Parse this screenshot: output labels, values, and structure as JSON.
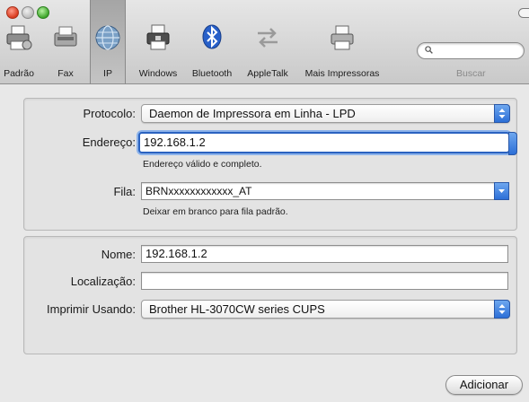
{
  "toolbar": {
    "items": [
      {
        "label": "Padrão",
        "icon": "printer-default-icon"
      },
      {
        "label": "Fax",
        "icon": "fax-icon"
      },
      {
        "label": "IP",
        "icon": "globe-icon"
      },
      {
        "label": "Windows",
        "icon": "windows-printer-icon"
      },
      {
        "label": "Bluetooth",
        "icon": "bluetooth-icon"
      },
      {
        "label": "AppleTalk",
        "icon": "appletalk-icon"
      },
      {
        "label": "Mais Impressoras",
        "icon": "more-printers-icon"
      }
    ],
    "selected": "IP",
    "search": {
      "label": "Buscar",
      "value": ""
    }
  },
  "connection": {
    "protocol_label": "Protocolo:",
    "protocol_value": "Daemon de Impressora em Linha - LPD",
    "address_label": "Endereço:",
    "address_value": "192.168.1.2",
    "address_hint": "Endereço válido e completo.",
    "queue_label": "Fila:",
    "queue_value": "BRNxxxxxxxxxxxx_AT",
    "queue_hint": "Deixar em branco para fila padrão."
  },
  "printer": {
    "name_label": "Nome:",
    "name_value": "192.168.1.2",
    "location_label": "Localização:",
    "location_value": "",
    "driver_label": "Imprimir Usando:",
    "driver_value": "Brother HL-3070CW series CUPS"
  },
  "actions": {
    "add_label": "Adicionar"
  },
  "colors": {
    "accent": "#2c6fd7",
    "focus_ring": "#2a62c0"
  }
}
